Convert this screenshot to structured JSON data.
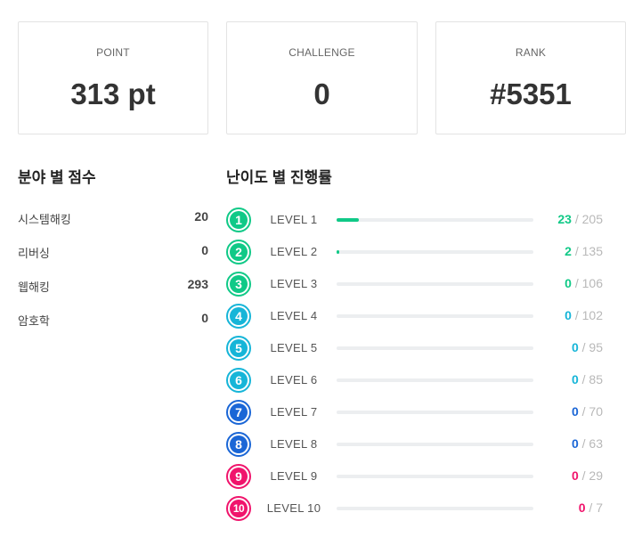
{
  "stats": {
    "point": {
      "label": "POINT",
      "value": "313 pt"
    },
    "challenge": {
      "label": "CHALLENGE",
      "value": "0"
    },
    "rank": {
      "label": "RANK",
      "value": "#5351"
    }
  },
  "field_scores": {
    "title": "분야 별 점수",
    "items": [
      {
        "name": "시스템해킹",
        "score": "20"
      },
      {
        "name": "리버싱",
        "score": "0"
      },
      {
        "name": "웹해킹",
        "score": "293"
      },
      {
        "name": "암호학",
        "score": "0"
      }
    ]
  },
  "level_progress": {
    "title": "난이도 별 진행률",
    "separator": "/",
    "levels": [
      {
        "num": "1",
        "label": "LEVEL 1",
        "solved": "23",
        "total": "205",
        "color": "#10c987"
      },
      {
        "num": "2",
        "label": "LEVEL 2",
        "solved": "2",
        "total": "135",
        "color": "#10c987"
      },
      {
        "num": "3",
        "label": "LEVEL 3",
        "solved": "0",
        "total": "106",
        "color": "#10c987"
      },
      {
        "num": "4",
        "label": "LEVEL 4",
        "solved": "0",
        "total": "102",
        "color": "#16b5d8"
      },
      {
        "num": "5",
        "label": "LEVEL 5",
        "solved": "0",
        "total": "95",
        "color": "#16b5d8"
      },
      {
        "num": "6",
        "label": "LEVEL 6",
        "solved": "0",
        "total": "85",
        "color": "#16b5d8"
      },
      {
        "num": "7",
        "label": "LEVEL 7",
        "solved": "0",
        "total": "70",
        "color": "#1a66d6"
      },
      {
        "num": "8",
        "label": "LEVEL 8",
        "solved": "0",
        "total": "63",
        "color": "#1a66d6"
      },
      {
        "num": "9",
        "label": "LEVEL 9",
        "solved": "0",
        "total": "29",
        "color": "#f0146c"
      },
      {
        "num": "10",
        "label": "LEVEL 10",
        "solved": "0",
        "total": "7",
        "color": "#f0146c"
      }
    ]
  }
}
